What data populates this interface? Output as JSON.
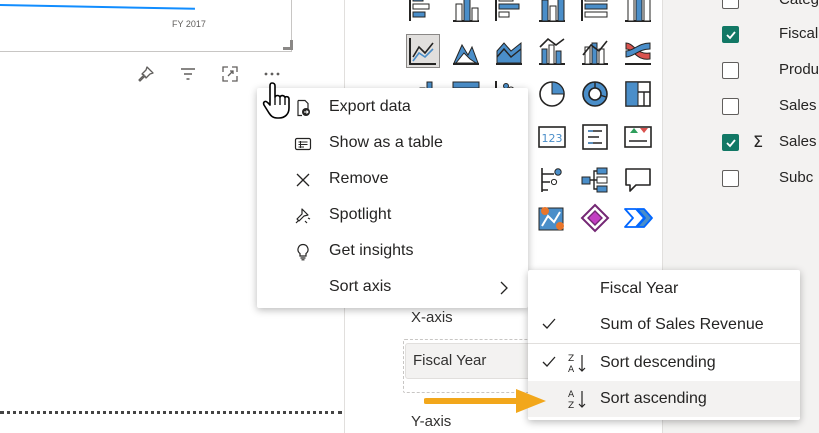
{
  "canvas": {
    "axis_tick_label": "FY 2017",
    "visual_header_icons": [
      "pin-icon",
      "filter-icon",
      "focus-mode-icon",
      "more-options-icon"
    ]
  },
  "context_menu": {
    "items": [
      {
        "label": "Export data",
        "icon": "export-data-icon"
      },
      {
        "label": "Show as a table",
        "icon": "table-view-icon"
      },
      {
        "label": "Remove",
        "icon": "close-icon"
      },
      {
        "label": "Spotlight",
        "icon": "spotlight-icon"
      },
      {
        "label": "Get insights",
        "icon": "lightbulb-icon"
      },
      {
        "label": "Sort axis",
        "icon": "",
        "has_submenu": true
      }
    ]
  },
  "submenu": {
    "items": [
      {
        "label": "Fiscal Year",
        "checked": false
      },
      {
        "label": "Sum of Sales Revenue",
        "checked": true
      },
      {
        "label": "Sort descending",
        "checked": true,
        "icon": "sort-za-icon"
      },
      {
        "label": "Sort ascending",
        "checked": false,
        "icon": "sort-az-icon",
        "hovered": true
      }
    ]
  },
  "viz_pane": {
    "xaxis_label": "X-axis",
    "xaxis_field": "Fiscal Year",
    "yaxis_label": "Y-axis",
    "selected_visual": "line-chart-icon"
  },
  "fields_pane": {
    "fields": [
      {
        "label": "Categ",
        "checked": false,
        "sigma": false
      },
      {
        "label": "Fiscal",
        "checked": true,
        "sigma": false
      },
      {
        "label": "Produ",
        "checked": false,
        "sigma": false
      },
      {
        "label": "Sales",
        "checked": false,
        "sigma": false
      },
      {
        "label": "Sales",
        "checked": true,
        "sigma": true
      },
      {
        "label": "Subc",
        "checked": false,
        "sigma": false
      }
    ]
  },
  "colors": {
    "accent": "#118dff",
    "check_green": "#117865",
    "highlight_arrow": "#f2a71b",
    "pane_bg": "#f3f2f1"
  }
}
